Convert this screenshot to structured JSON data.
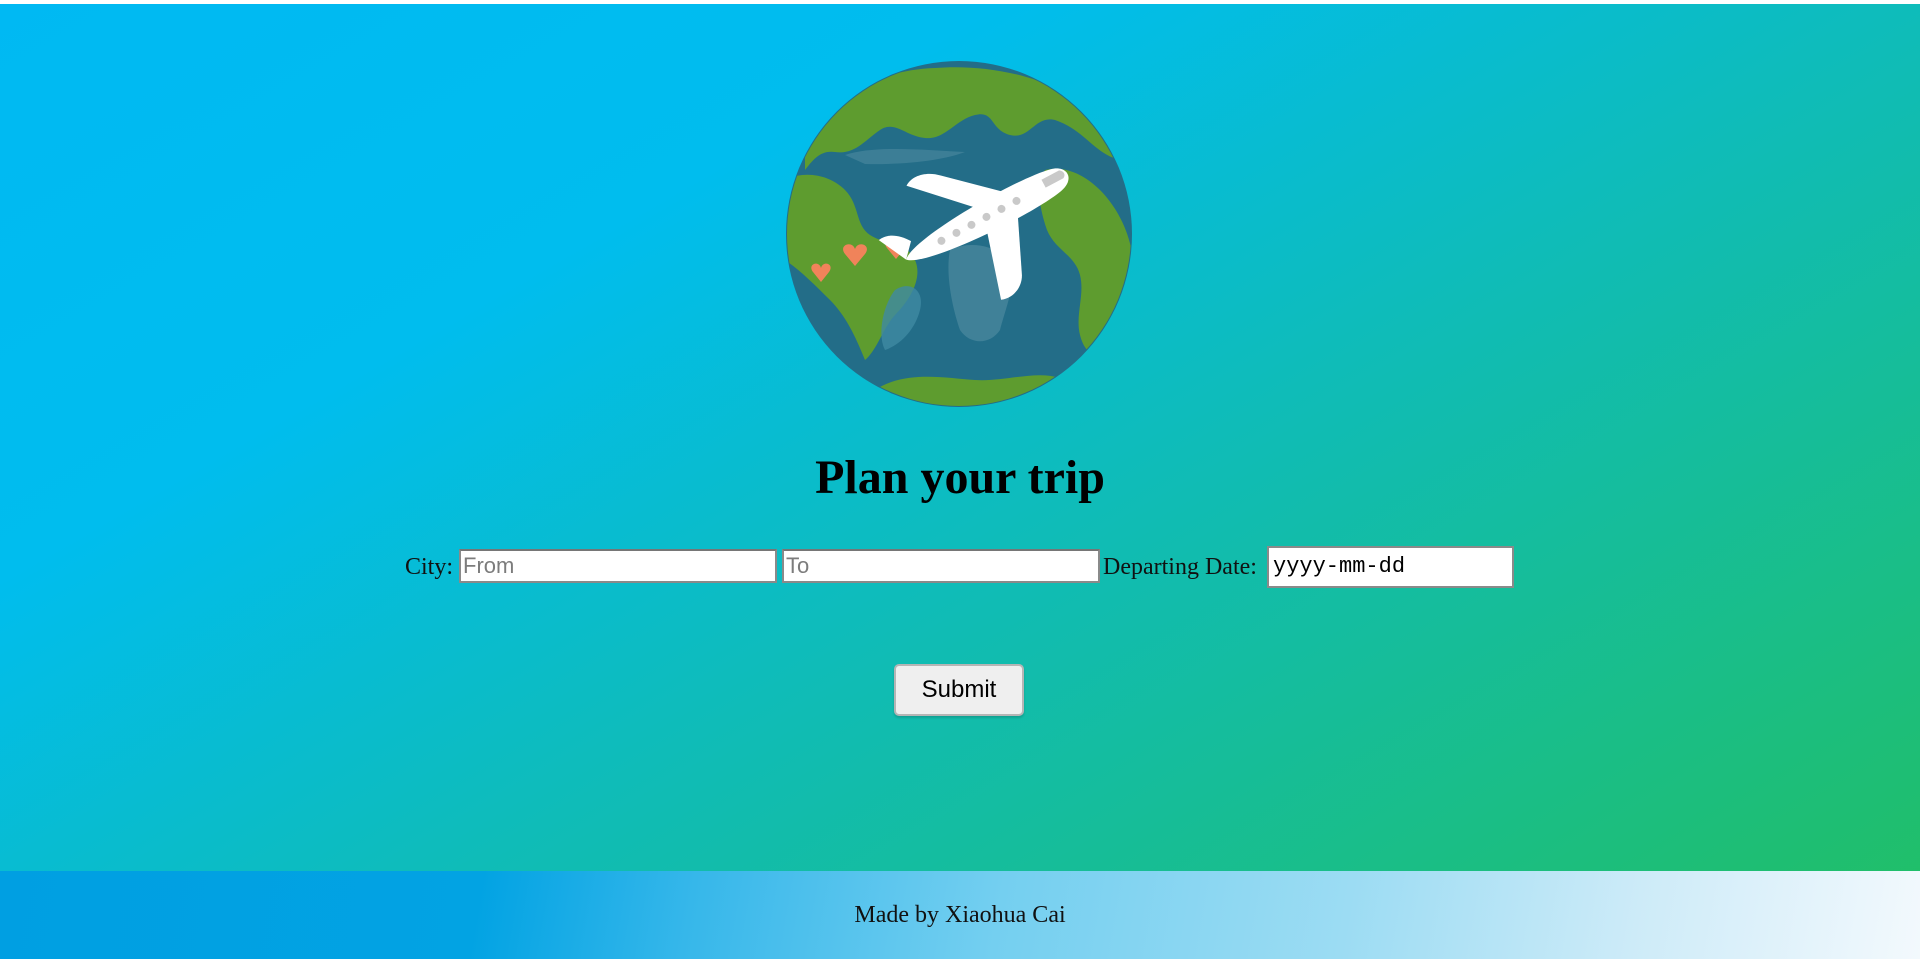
{
  "header": {
    "logo_icon": "globe-airplane-icon"
  },
  "main": {
    "title": "Plan your trip",
    "form": {
      "city_label": "City:",
      "from_placeholder": "From",
      "to_placeholder": "To",
      "date_label": "Departing Date:",
      "date_value": "yyyy-mm-dd",
      "submit_label": "Submit"
    }
  },
  "footer": {
    "text": "Made by Xiaohua Cai"
  },
  "colors": {
    "gradient_start": "#00b9f3",
    "gradient_end": "#22bf62",
    "ocean": "#236d88",
    "land": "#5e9c2f",
    "heart": "#f0835a"
  }
}
